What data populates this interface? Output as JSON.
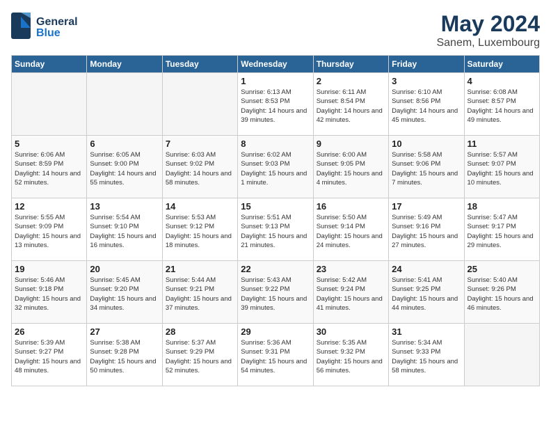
{
  "header": {
    "logo_line1": "General",
    "logo_line2": "Blue",
    "month": "May 2024",
    "location": "Sanem, Luxembourg"
  },
  "weekdays": [
    "Sunday",
    "Monday",
    "Tuesday",
    "Wednesday",
    "Thursday",
    "Friday",
    "Saturday"
  ],
  "weeks": [
    [
      {
        "day": "",
        "empty": true
      },
      {
        "day": "",
        "empty": true
      },
      {
        "day": "",
        "empty": true
      },
      {
        "day": "1",
        "sunrise": "Sunrise: 6:13 AM",
        "sunset": "Sunset: 8:53 PM",
        "daylight": "Daylight: 14 hours and 39 minutes."
      },
      {
        "day": "2",
        "sunrise": "Sunrise: 6:11 AM",
        "sunset": "Sunset: 8:54 PM",
        "daylight": "Daylight: 14 hours and 42 minutes."
      },
      {
        "day": "3",
        "sunrise": "Sunrise: 6:10 AM",
        "sunset": "Sunset: 8:56 PM",
        "daylight": "Daylight: 14 hours and 45 minutes."
      },
      {
        "day": "4",
        "sunrise": "Sunrise: 6:08 AM",
        "sunset": "Sunset: 8:57 PM",
        "daylight": "Daylight: 14 hours and 49 minutes."
      }
    ],
    [
      {
        "day": "5",
        "sunrise": "Sunrise: 6:06 AM",
        "sunset": "Sunset: 8:59 PM",
        "daylight": "Daylight: 14 hours and 52 minutes."
      },
      {
        "day": "6",
        "sunrise": "Sunrise: 6:05 AM",
        "sunset": "Sunset: 9:00 PM",
        "daylight": "Daylight: 14 hours and 55 minutes."
      },
      {
        "day": "7",
        "sunrise": "Sunrise: 6:03 AM",
        "sunset": "Sunset: 9:02 PM",
        "daylight": "Daylight: 14 hours and 58 minutes."
      },
      {
        "day": "8",
        "sunrise": "Sunrise: 6:02 AM",
        "sunset": "Sunset: 9:03 PM",
        "daylight": "Daylight: 15 hours and 1 minute."
      },
      {
        "day": "9",
        "sunrise": "Sunrise: 6:00 AM",
        "sunset": "Sunset: 9:05 PM",
        "daylight": "Daylight: 15 hours and 4 minutes."
      },
      {
        "day": "10",
        "sunrise": "Sunrise: 5:58 AM",
        "sunset": "Sunset: 9:06 PM",
        "daylight": "Daylight: 15 hours and 7 minutes."
      },
      {
        "day": "11",
        "sunrise": "Sunrise: 5:57 AM",
        "sunset": "Sunset: 9:07 PM",
        "daylight": "Daylight: 15 hours and 10 minutes."
      }
    ],
    [
      {
        "day": "12",
        "sunrise": "Sunrise: 5:55 AM",
        "sunset": "Sunset: 9:09 PM",
        "daylight": "Daylight: 15 hours and 13 minutes."
      },
      {
        "day": "13",
        "sunrise": "Sunrise: 5:54 AM",
        "sunset": "Sunset: 9:10 PM",
        "daylight": "Daylight: 15 hours and 16 minutes."
      },
      {
        "day": "14",
        "sunrise": "Sunrise: 5:53 AM",
        "sunset": "Sunset: 9:12 PM",
        "daylight": "Daylight: 15 hours and 18 minutes."
      },
      {
        "day": "15",
        "sunrise": "Sunrise: 5:51 AM",
        "sunset": "Sunset: 9:13 PM",
        "daylight": "Daylight: 15 hours and 21 minutes."
      },
      {
        "day": "16",
        "sunrise": "Sunrise: 5:50 AM",
        "sunset": "Sunset: 9:14 PM",
        "daylight": "Daylight: 15 hours and 24 minutes."
      },
      {
        "day": "17",
        "sunrise": "Sunrise: 5:49 AM",
        "sunset": "Sunset: 9:16 PM",
        "daylight": "Daylight: 15 hours and 27 minutes."
      },
      {
        "day": "18",
        "sunrise": "Sunrise: 5:47 AM",
        "sunset": "Sunset: 9:17 PM",
        "daylight": "Daylight: 15 hours and 29 minutes."
      }
    ],
    [
      {
        "day": "19",
        "sunrise": "Sunrise: 5:46 AM",
        "sunset": "Sunset: 9:18 PM",
        "daylight": "Daylight: 15 hours and 32 minutes."
      },
      {
        "day": "20",
        "sunrise": "Sunrise: 5:45 AM",
        "sunset": "Sunset: 9:20 PM",
        "daylight": "Daylight: 15 hours and 34 minutes."
      },
      {
        "day": "21",
        "sunrise": "Sunrise: 5:44 AM",
        "sunset": "Sunset: 9:21 PM",
        "daylight": "Daylight: 15 hours and 37 minutes."
      },
      {
        "day": "22",
        "sunrise": "Sunrise: 5:43 AM",
        "sunset": "Sunset: 9:22 PM",
        "daylight": "Daylight: 15 hours and 39 minutes."
      },
      {
        "day": "23",
        "sunrise": "Sunrise: 5:42 AM",
        "sunset": "Sunset: 9:24 PM",
        "daylight": "Daylight: 15 hours and 41 minutes."
      },
      {
        "day": "24",
        "sunrise": "Sunrise: 5:41 AM",
        "sunset": "Sunset: 9:25 PM",
        "daylight": "Daylight: 15 hours and 44 minutes."
      },
      {
        "day": "25",
        "sunrise": "Sunrise: 5:40 AM",
        "sunset": "Sunset: 9:26 PM",
        "daylight": "Daylight: 15 hours and 46 minutes."
      }
    ],
    [
      {
        "day": "26",
        "sunrise": "Sunrise: 5:39 AM",
        "sunset": "Sunset: 9:27 PM",
        "daylight": "Daylight: 15 hours and 48 minutes."
      },
      {
        "day": "27",
        "sunrise": "Sunrise: 5:38 AM",
        "sunset": "Sunset: 9:28 PM",
        "daylight": "Daylight: 15 hours and 50 minutes."
      },
      {
        "day": "28",
        "sunrise": "Sunrise: 5:37 AM",
        "sunset": "Sunset: 9:29 PM",
        "daylight": "Daylight: 15 hours and 52 minutes."
      },
      {
        "day": "29",
        "sunrise": "Sunrise: 5:36 AM",
        "sunset": "Sunset: 9:31 PM",
        "daylight": "Daylight: 15 hours and 54 minutes."
      },
      {
        "day": "30",
        "sunrise": "Sunrise: 5:35 AM",
        "sunset": "Sunset: 9:32 PM",
        "daylight": "Daylight: 15 hours and 56 minutes."
      },
      {
        "day": "31",
        "sunrise": "Sunrise: 5:34 AM",
        "sunset": "Sunset: 9:33 PM",
        "daylight": "Daylight: 15 hours and 58 minutes."
      },
      {
        "day": "",
        "empty": true
      }
    ]
  ]
}
